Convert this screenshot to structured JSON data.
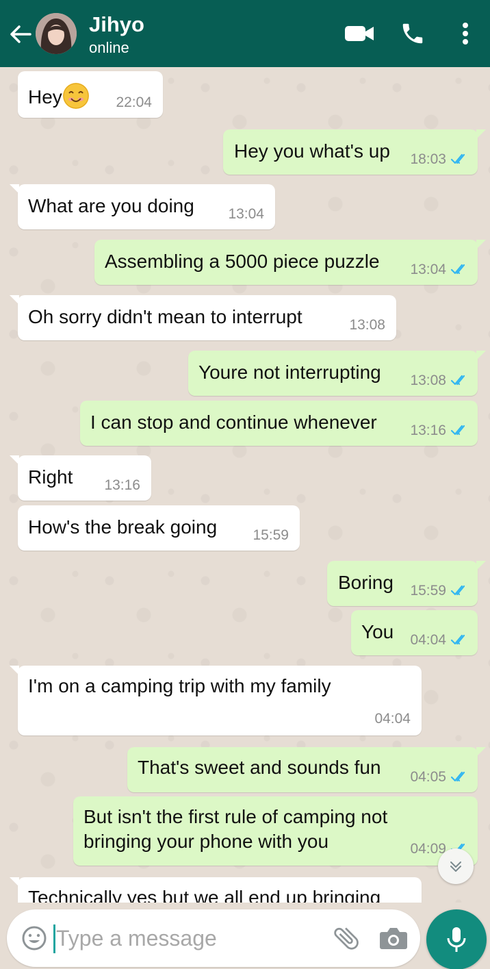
{
  "header": {
    "contact_name": "Jihyo",
    "contact_status": "online",
    "icons": [
      "back-arrow-icon",
      "video-call-icon",
      "phone-icon",
      "more-vert-icon"
    ]
  },
  "messages": [
    {
      "direction": "in",
      "text": "Hey",
      "emoji": "smiling-face",
      "time": "22:04"
    },
    {
      "direction": "out",
      "text": "Hey you what's up",
      "time": "18:03",
      "status": "read"
    },
    {
      "direction": "in",
      "text": "What are you doing",
      "time": "13:04"
    },
    {
      "direction": "out",
      "text": "Assembling a 5000 piece puzzle",
      "time": "13:04",
      "status": "read"
    },
    {
      "direction": "in",
      "text": "Oh sorry didn't mean to interrupt",
      "time": "13:08"
    },
    {
      "direction": "out",
      "text": "Youre not interrupting",
      "time": "13:08",
      "status": "read"
    },
    {
      "direction": "out",
      "text": "I can stop and continue whenever",
      "time": "13:16",
      "status": "read"
    },
    {
      "direction": "in",
      "text": "Right",
      "time": "13:16"
    },
    {
      "direction": "in",
      "text": "How's the break going",
      "time": "15:59"
    },
    {
      "direction": "out",
      "text": "Boring",
      "time": "15:59",
      "status": "read"
    },
    {
      "direction": "out",
      "text": "You",
      "time": "04:04",
      "status": "read"
    },
    {
      "direction": "in",
      "text": "I'm on a camping trip with my family",
      "time": "04:04"
    },
    {
      "direction": "out",
      "text": "That's sweet and sounds fun",
      "time": "04:05",
      "status": "read"
    },
    {
      "direction": "out",
      "text": "But isn't the first rule of camping not bringing your phone with you",
      "time": "04:09",
      "status": "read"
    },
    {
      "direction": "in",
      "text": "Technically yes but we all end up bringing"
    }
  ],
  "composer": {
    "placeholder": "Type a message",
    "icons": [
      "emoji-icon",
      "attach-icon",
      "camera-icon",
      "mic-icon"
    ]
  },
  "colors": {
    "header": "#075e54",
    "outgoing_bubble": "#dcf8c6",
    "incoming_bubble": "#ffffff",
    "read_tick": "#34b7f1",
    "mic_button": "#128c7e",
    "chat_background": "#e6ddd4"
  }
}
